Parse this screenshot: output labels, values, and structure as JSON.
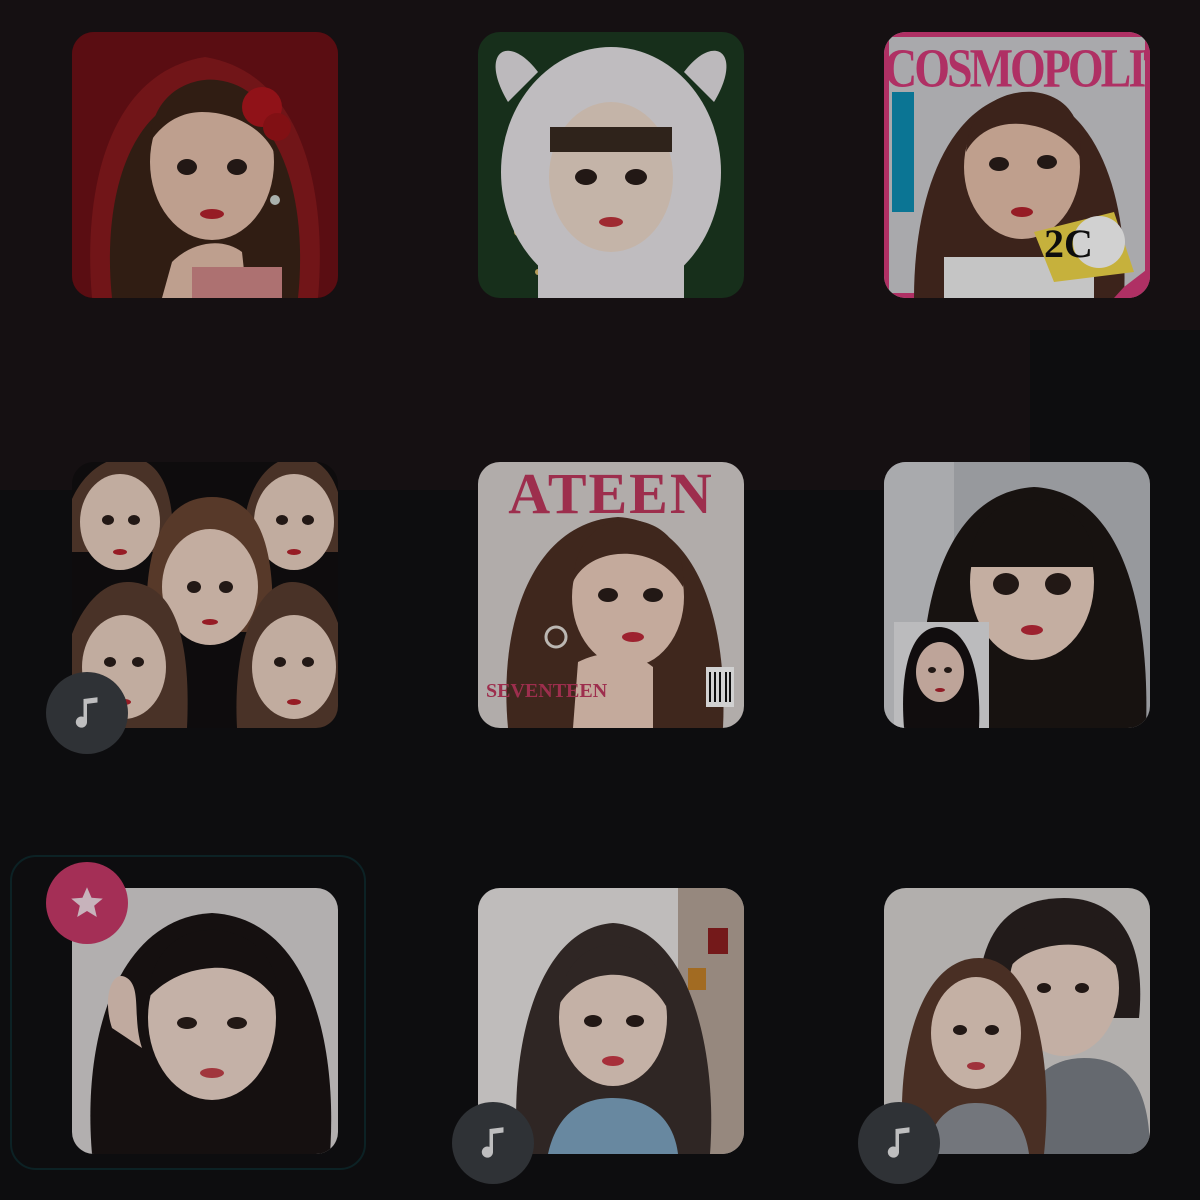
{
  "gallery": {
    "tiles": [
      {
        "id": "avatar-red-hood",
        "theme": "red-rose-hood",
        "badge": null
      },
      {
        "id": "avatar-bunny-hood",
        "theme": "white-bunny-costume",
        "badge": null
      },
      {
        "id": "avatar-cosmopolitan",
        "theme": "magazine-cover",
        "badge": null,
        "cover_title": "COSMOPOLITAN",
        "cover_tag": "2C"
      },
      {
        "id": "avatar-group-collage",
        "theme": "five-faces-collage",
        "badge": "music-note-icon"
      },
      {
        "id": "avatar-magazine-teen",
        "theme": "magazine-cover",
        "badge": null,
        "cover_title": "ATEEN",
        "cover_footer": "SEVENTEEN"
      },
      {
        "id": "avatar-dark-hair-selfie",
        "theme": "selfie-with-friend",
        "badge": null
      },
      {
        "id": "avatar-realistic-portrait",
        "theme": "realistic-portrait",
        "badge": "star-icon",
        "selected": true
      },
      {
        "id": "avatar-sketch-portrait",
        "theme": "art-studio",
        "badge": "music-note-icon"
      },
      {
        "id": "avatar-couple",
        "theme": "couple-photo",
        "badge": "music-note-icon"
      }
    ]
  },
  "colors": {
    "background": "#111113",
    "upper_band": "#1a1416",
    "music_badge": "#3a3d42",
    "favorite_badge": "#c93a6a",
    "cosmo_title": "#d63b7a",
    "ateen_title": "#c0395f"
  }
}
